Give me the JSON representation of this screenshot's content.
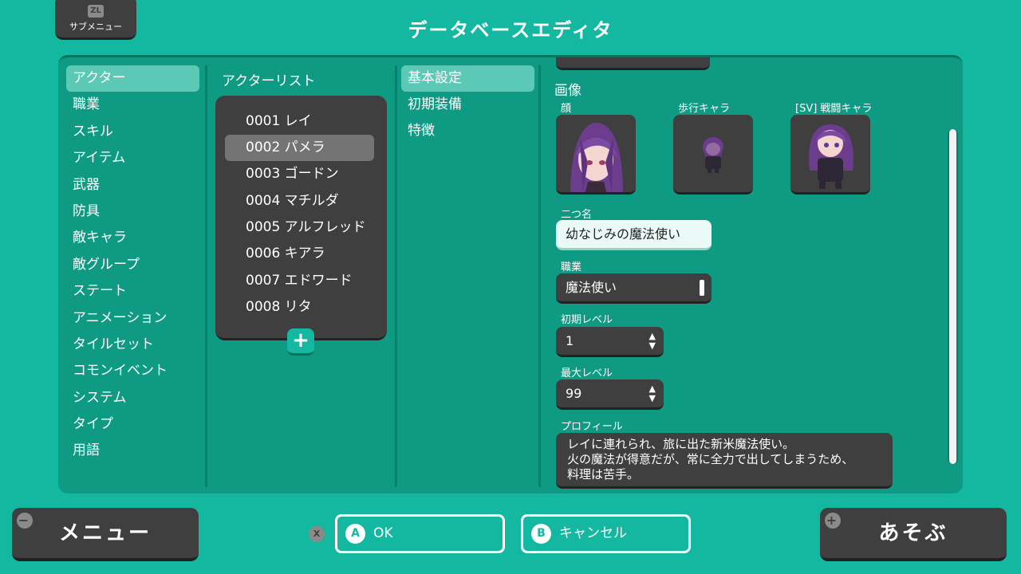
{
  "header": {
    "title": "データベースエディタ",
    "submenu_key": "ZL",
    "submenu_label": "サブメニュー"
  },
  "categories": [
    {
      "label": "アクター",
      "selected": true
    },
    {
      "label": "職業"
    },
    {
      "label": "スキル"
    },
    {
      "label": "アイテム"
    },
    {
      "label": "武器"
    },
    {
      "label": "防具"
    },
    {
      "label": "敵キャラ"
    },
    {
      "label": "敵グループ"
    },
    {
      "label": "ステート"
    },
    {
      "label": "アニメーション"
    },
    {
      "label": "タイルセット"
    },
    {
      "label": "コモンイベント"
    },
    {
      "label": "システム"
    },
    {
      "label": "タイプ"
    },
    {
      "label": "用語"
    }
  ],
  "actor_list": {
    "title": "アクターリスト",
    "add_icon": "+",
    "items": [
      {
        "label": "0001 レイ"
      },
      {
        "label": "0002 パメラ",
        "selected": true
      },
      {
        "label": "0003 ゴードン"
      },
      {
        "label": "0004 マチルダ"
      },
      {
        "label": "0005 アルフレッド"
      },
      {
        "label": "0006 キアラ"
      },
      {
        "label": "0007 エドワード"
      },
      {
        "label": "0008 リタ"
      }
    ]
  },
  "tabs": [
    {
      "label": "基本設定",
      "selected": true
    },
    {
      "label": "初期装備"
    },
    {
      "label": "特徴"
    }
  ],
  "form": {
    "image_section": "画像",
    "face_label": "顔",
    "walk_label": "歩行キャラ",
    "battler_label": "[SV] 戦闘キャラ",
    "nickname_label": "二つ名",
    "nickname_value": "幼なじみの魔法使い",
    "class_label": "職業",
    "class_value": "魔法使い",
    "init_level_label": "初期レベル",
    "init_level_value": "1",
    "max_level_label": "最大レベル",
    "max_level_value": "99",
    "profile_label": "プロフィール",
    "profile_value": "レイに連れられ、旅に出た新米魔法使い。\n火の魔法が得意だが、常に全力で出してしまうため、\n料理は苦手。"
  },
  "footer": {
    "menu_label": "メニュー",
    "menu_key": "−",
    "x_key": "X",
    "ok_key": "A",
    "ok_label": "OK",
    "cancel_key": "B",
    "cancel_label": "キャンセル",
    "play_label": "あそぶ",
    "play_key": "+"
  },
  "colors": {
    "background": "#14b8a0",
    "panel": "#0f9a84",
    "dark": "#3f3f3f",
    "highlight": "#5cc9b6"
  }
}
